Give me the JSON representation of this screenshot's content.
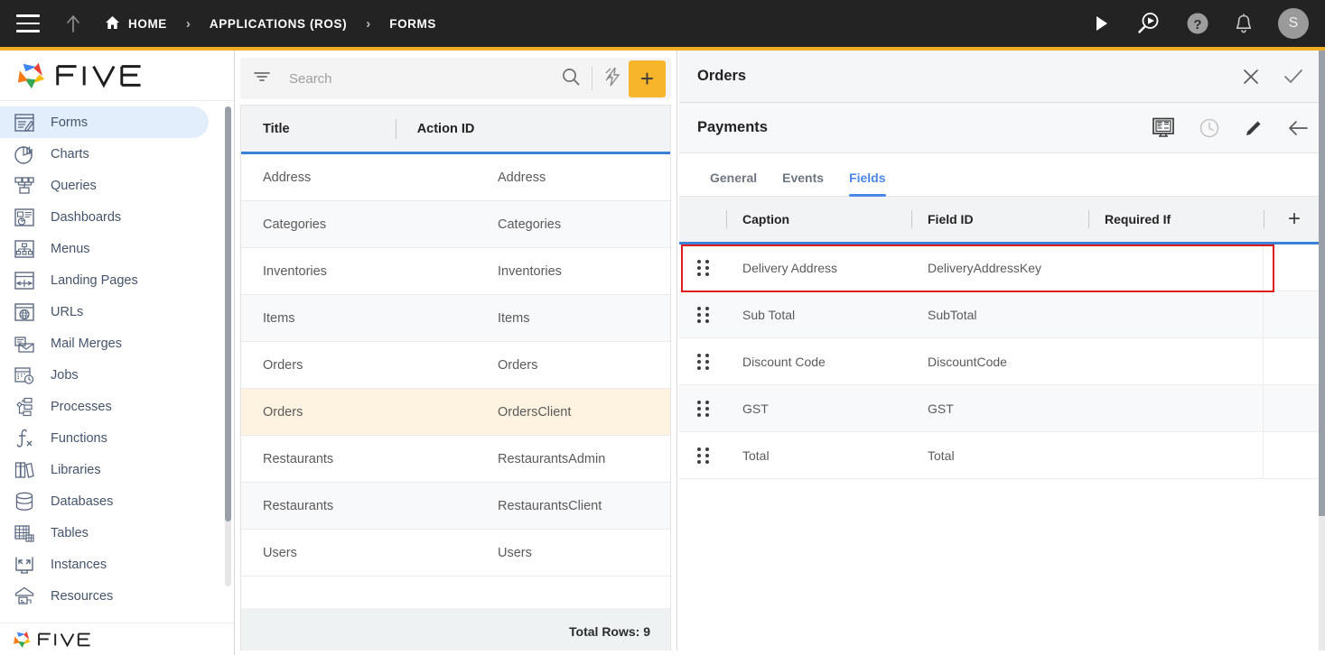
{
  "topbar": {
    "menu_icon": "hamburger-icon",
    "up_icon": "arrow-up-icon",
    "breadcrumbs": [
      {
        "label": "HOME",
        "icon": "home-icon"
      },
      {
        "label": "APPLICATIONS (ROS)",
        "icon": ""
      },
      {
        "label": "FORMS",
        "icon": ""
      }
    ],
    "separator": "›",
    "actions": [
      {
        "name": "run-icon",
        "label": ""
      },
      {
        "name": "search-run-icon",
        "label": ""
      },
      {
        "name": "help-icon",
        "label": ""
      },
      {
        "name": "notifications-bell-icon",
        "label": ""
      }
    ],
    "avatar_initial": "S",
    "accent_color": "#f0ad21",
    "background_color": "#232323"
  },
  "sidebar": {
    "brand": "FIVE",
    "brand_footer": "FIVE",
    "items": [
      {
        "label": "Forms",
        "icon": "forms-icon",
        "active": true
      },
      {
        "label": "Charts",
        "icon": "charts-icon",
        "active": false
      },
      {
        "label": "Queries",
        "icon": "queries-icon",
        "active": false
      },
      {
        "label": "Dashboards",
        "icon": "dashboards-icon",
        "active": false
      },
      {
        "label": "Menus",
        "icon": "menus-icon",
        "active": false
      },
      {
        "label": "Landing Pages",
        "icon": "landing-pages-icon",
        "active": false
      },
      {
        "label": "URLs",
        "icon": "urls-icon",
        "active": false
      },
      {
        "label": "Mail Merges",
        "icon": "mail-merges-icon",
        "active": false
      },
      {
        "label": "Jobs",
        "icon": "jobs-icon",
        "active": false
      },
      {
        "label": "Processes",
        "icon": "processes-icon",
        "active": false
      },
      {
        "label": "Functions",
        "icon": "functions-icon",
        "active": false
      },
      {
        "label": "Libraries",
        "icon": "libraries-icon",
        "active": false
      },
      {
        "label": "Databases",
        "icon": "databases-icon",
        "active": false
      },
      {
        "label": "Tables",
        "icon": "tables-icon",
        "active": false
      },
      {
        "label": "Instances",
        "icon": "instances-icon",
        "active": false
      },
      {
        "label": "Resources",
        "icon": "resources-icon",
        "active": false
      }
    ],
    "active_color": "#e3eefc"
  },
  "list_panel": {
    "search": {
      "value": "",
      "placeholder": "Search"
    },
    "filter_icon": "filter-icon",
    "search_icon": "search-icon",
    "lightning_icon": "lightning-bolt-icon",
    "add_label": "+",
    "add_color": "#f7b52c",
    "columns": [
      "Title",
      "Action ID"
    ],
    "rows": [
      {
        "title": "Address",
        "action_id": "Address",
        "selected": false
      },
      {
        "title": "Categories",
        "action_id": "Categories",
        "selected": false
      },
      {
        "title": "Inventories",
        "action_id": "Inventories",
        "selected": false
      },
      {
        "title": "Items",
        "action_id": "Items",
        "selected": false
      },
      {
        "title": "Orders",
        "action_id": "Orders",
        "selected": false
      },
      {
        "title": "Orders",
        "action_id": "OrdersClient",
        "selected": true
      },
      {
        "title": "Restaurants",
        "action_id": "RestaurantsAdmin",
        "selected": false
      },
      {
        "title": "Restaurants",
        "action_id": "RestaurantsClient",
        "selected": false
      },
      {
        "title": "Users",
        "action_id": "Users",
        "selected": false
      }
    ],
    "footer_total": "Total Rows: 9",
    "selected_row_color": "#fdf3e0"
  },
  "right_panel": {
    "title": "Orders",
    "close_icon": "close-icon",
    "confirm_icon": "check-icon",
    "subtitle": "Payments",
    "sub_actions": [
      {
        "name": "display-designer-icon"
      },
      {
        "name": "history-clock-icon"
      },
      {
        "name": "edit-pencil-icon"
      },
      {
        "name": "back-arrow-icon"
      }
    ],
    "tabs": [
      {
        "label": "General",
        "active": false
      },
      {
        "label": "Events",
        "active": false
      },
      {
        "label": "Fields",
        "active": true
      }
    ],
    "active_tab_color": "#4a86e8",
    "fields_table": {
      "columns": [
        "Caption",
        "Field ID",
        "Required If"
      ],
      "add_label": "+",
      "rows": [
        {
          "caption": "Delivery Address",
          "field_id": "DeliveryAddressKey",
          "required_if": "",
          "highlighted": true
        },
        {
          "caption": "Sub Total",
          "field_id": "SubTotal",
          "required_if": "",
          "highlighted": false
        },
        {
          "caption": "Discount Code",
          "field_id": "DiscountCode",
          "required_if": "",
          "highlighted": false
        },
        {
          "caption": "GST",
          "field_id": "GST",
          "required_if": "",
          "highlighted": false
        },
        {
          "caption": "Total",
          "field_id": "Total",
          "required_if": "",
          "highlighted": false
        }
      ],
      "highlight_color": "#e01b1b"
    }
  }
}
